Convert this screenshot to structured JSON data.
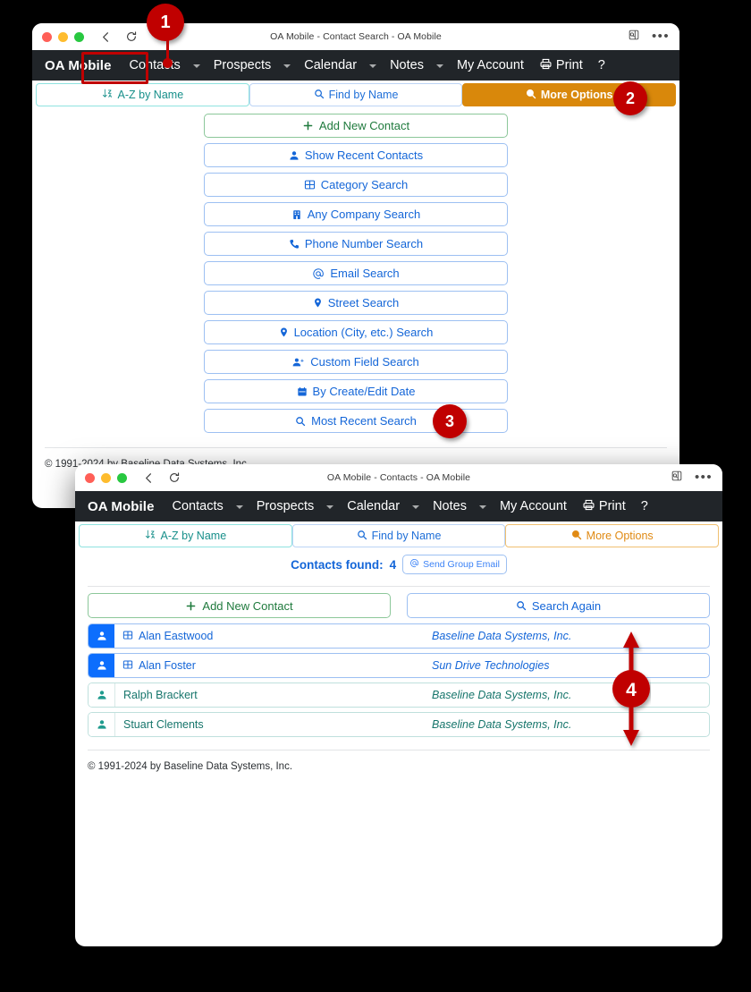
{
  "windows": {
    "back": {
      "title": "OA Mobile - Contact Search - OA Mobile",
      "appbar": {
        "brand": "OA Mobile",
        "items": [
          {
            "label": "Contacts",
            "caret": true
          },
          {
            "label": "Prospects",
            "caret": true
          },
          {
            "label": "Calendar",
            "caret": true
          },
          {
            "label": "Notes",
            "caret": true
          },
          {
            "label": "My Account",
            "caret": false
          }
        ],
        "print_label": "Print",
        "help_label": "?"
      },
      "tabs": [
        {
          "label": "A-Z by Name",
          "icon": "sort-az-icon",
          "state": "az"
        },
        {
          "label": "Find by Name",
          "icon": "search-icon",
          "state": "find"
        },
        {
          "label": "More Options",
          "icon": "search-plus-icon",
          "state": "active-filled"
        }
      ],
      "buttons": [
        {
          "label": "Add New Contact",
          "icon": "plus-icon",
          "style": "green"
        },
        {
          "label": "Show Recent Contacts",
          "icon": "person-icon",
          "style": "blue"
        },
        {
          "label": "Category Search",
          "icon": "grid-icon",
          "style": "blue"
        },
        {
          "label": "Any Company Search",
          "icon": "building-icon",
          "style": "blue"
        },
        {
          "label": "Phone Number Search",
          "icon": "phone-icon",
          "style": "blue"
        },
        {
          "label": "Email Search",
          "icon": "at-icon",
          "style": "blue"
        },
        {
          "label": "Street Search",
          "icon": "map-pin-icon",
          "style": "blue"
        },
        {
          "label": "Location (City, etc.) Search",
          "icon": "map-pin-icon",
          "style": "blue"
        },
        {
          "label": "Custom Field Search",
          "icon": "person-plus-icon",
          "style": "blue"
        },
        {
          "label": "By Create/Edit Date",
          "icon": "calendar-icon",
          "style": "blue"
        },
        {
          "label": "Most Recent Search",
          "icon": "search-icon",
          "style": "blue"
        }
      ],
      "copyright": "© 1991-2024 by Baseline Data Systems, Inc."
    },
    "front": {
      "title": "OA Mobile - Contacts - OA Mobile",
      "appbar": {
        "brand": "OA Mobile",
        "items": [
          {
            "label": "Contacts",
            "caret": true
          },
          {
            "label": "Prospects",
            "caret": true
          },
          {
            "label": "Calendar",
            "caret": true
          },
          {
            "label": "Notes",
            "caret": true
          },
          {
            "label": "My Account",
            "caret": false
          }
        ],
        "print_label": "Print",
        "help_label": "?"
      },
      "tabs": [
        {
          "label": "A-Z by Name",
          "icon": "sort-az-icon",
          "state": "az"
        },
        {
          "label": "Find by Name",
          "icon": "search-icon",
          "state": "find"
        },
        {
          "label": "More Options",
          "icon": "search-plus-icon",
          "state": "active-outline"
        }
      ],
      "results": {
        "found_label": "Contacts found:",
        "found_count": "4",
        "send_group_email_label": "Send Group Email",
        "add_new_contact_label": "Add New Contact",
        "search_again_label": "Search Again",
        "rows": [
          {
            "name": "Alan Eastwood",
            "company": "Baseline Data Systems, Inc.",
            "selected": true
          },
          {
            "name": "Alan Foster",
            "company": "Sun Drive Technologies",
            "selected": true
          },
          {
            "name": "Ralph Brackert",
            "company": "Baseline Data Systems, Inc.",
            "selected": false
          },
          {
            "name": "Stuart Clements",
            "company": "Baseline Data Systems, Inc.",
            "selected": false
          }
        ]
      },
      "copyright": "© 1991-2024 by Baseline Data Systems, Inc."
    }
  },
  "callouts": [
    {
      "id": "1",
      "label": "1",
      "kind": "pin"
    },
    {
      "id": "2",
      "label": "2",
      "kind": "circle"
    },
    {
      "id": "3",
      "label": "3",
      "kind": "circle"
    },
    {
      "id": "4",
      "label": "4",
      "kind": "double-arrow"
    }
  ],
  "colors": {
    "callout_red": "#c00000",
    "appbar_dark": "#212529",
    "tab_active_orange": "#d9880b",
    "link_blue": "#1466d8",
    "teal": "#16756b",
    "selected_blue": "#0d6efd"
  }
}
